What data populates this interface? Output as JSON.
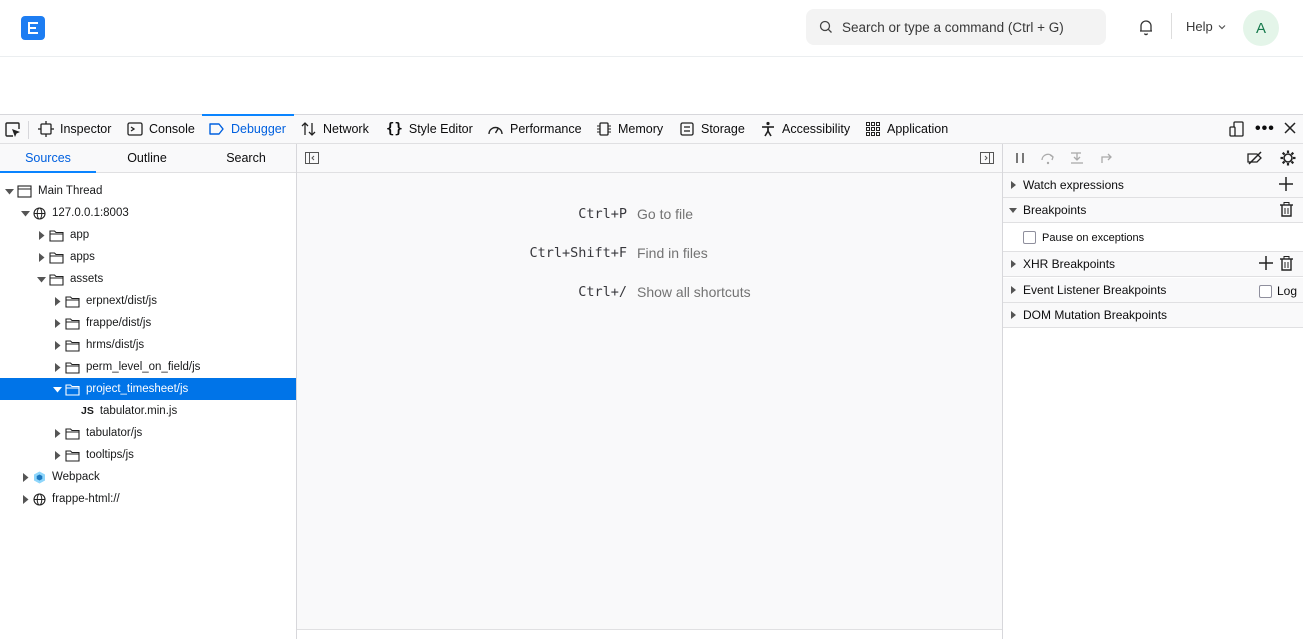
{
  "app": {
    "search_placeholder": "Search or type a command (Ctrl + G)",
    "help_label": "Help",
    "avatar_initial": "A",
    "brand_color": "#1d7df2"
  },
  "devtools": {
    "tabs": [
      {
        "label": "Inspector",
        "icon": "inspector-icon"
      },
      {
        "label": "Console",
        "icon": "console-icon"
      },
      {
        "label": "Debugger",
        "icon": "debugger-icon",
        "selected": true
      },
      {
        "label": "Network",
        "icon": "network-icon"
      },
      {
        "label": "Style Editor",
        "icon": "style-editor-icon"
      },
      {
        "label": "Performance",
        "icon": "performance-icon"
      },
      {
        "label": "Memory",
        "icon": "memory-icon"
      },
      {
        "label": "Storage",
        "icon": "storage-icon"
      },
      {
        "label": "Accessibility",
        "icon": "accessibility-icon"
      },
      {
        "label": "Application",
        "icon": "application-icon"
      }
    ],
    "accent_color": "#0a84ff"
  },
  "sources": {
    "subtabs": [
      "Sources",
      "Outline",
      "Search"
    ],
    "tree": [
      {
        "label": "Main Thread",
        "type": "thread",
        "expanded": true
      },
      {
        "label": "127.0.0.1:8003",
        "type": "domain",
        "expanded": true
      },
      {
        "label": "app",
        "type": "folder",
        "expanded": false
      },
      {
        "label": "apps",
        "type": "folder",
        "expanded": false
      },
      {
        "label": "assets",
        "type": "folder",
        "expanded": true
      },
      {
        "label": "erpnext/dist/js",
        "type": "folder",
        "expanded": false
      },
      {
        "label": "frappe/dist/js",
        "type": "folder",
        "expanded": false
      },
      {
        "label": "hrms/dist/js",
        "type": "folder",
        "expanded": false
      },
      {
        "label": "perm_level_on_field/js",
        "type": "folder",
        "expanded": false
      },
      {
        "label": "project_timesheet/js",
        "type": "folder",
        "expanded": true,
        "selected": true
      },
      {
        "label": "tabulator.min.js",
        "type": "js",
        "badge": "JS"
      },
      {
        "label": "tabulator/js",
        "type": "folder",
        "expanded": false
      },
      {
        "label": "tooltips/js",
        "type": "folder",
        "expanded": false
      },
      {
        "label": "Webpack",
        "type": "webpack",
        "expanded": false
      },
      {
        "label": "frappe-html://",
        "type": "domain",
        "expanded": false
      }
    ]
  },
  "editor": {
    "shortcuts": [
      {
        "keys": "Ctrl+P",
        "label": "Go to file"
      },
      {
        "keys": "Ctrl+Shift+F",
        "label": "Find in files"
      },
      {
        "keys": "Ctrl+/",
        "label": "Show all shortcuts"
      }
    ]
  },
  "panels": {
    "watch": "Watch expressions",
    "breakpoints": "Breakpoints",
    "pause_on_exceptions": "Pause on exceptions",
    "xhr": "XHR Breakpoints",
    "event_listener": "Event Listener Breakpoints",
    "log_label": "Log",
    "dom_mutation": "DOM Mutation Breakpoints"
  }
}
